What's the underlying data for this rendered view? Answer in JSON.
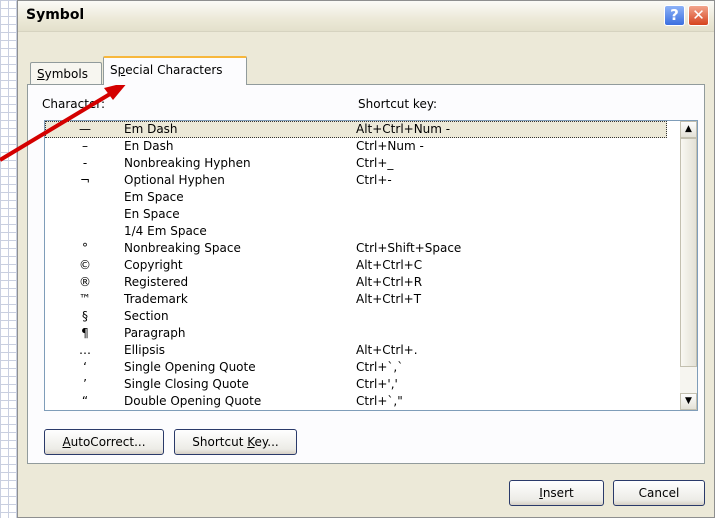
{
  "window": {
    "title": "Symbol"
  },
  "titlebar": {
    "help_glyph": "?",
    "close_glyph": "✕"
  },
  "tabs": [
    {
      "label_pre": "",
      "label_key": "S",
      "label_post": "ymbols"
    },
    {
      "label_pre": "S",
      "label_key": "p",
      "label_post": "ecial Characters"
    }
  ],
  "list": {
    "header_character": "Character:",
    "header_shortcut": "Shortcut key:",
    "rows": [
      {
        "symbol": "—",
        "name": "Em Dash",
        "shortcut": "Alt+Ctrl+Num -"
      },
      {
        "symbol": "–",
        "name": "En Dash",
        "shortcut": "Ctrl+Num -"
      },
      {
        "symbol": "-",
        "name": "Nonbreaking Hyphen",
        "shortcut": "Ctrl+_"
      },
      {
        "symbol": "¬",
        "name": "Optional Hyphen",
        "shortcut": "Ctrl+-"
      },
      {
        "symbol": "",
        "name": "Em Space",
        "shortcut": ""
      },
      {
        "symbol": "",
        "name": "En Space",
        "shortcut": ""
      },
      {
        "symbol": "",
        "name": "1/4 Em Space",
        "shortcut": ""
      },
      {
        "symbol": "°",
        "name": "Nonbreaking Space",
        "shortcut": "Ctrl+Shift+Space"
      },
      {
        "symbol": "©",
        "name": "Copyright",
        "shortcut": "Alt+Ctrl+C"
      },
      {
        "symbol": "®",
        "name": "Registered",
        "shortcut": "Alt+Ctrl+R"
      },
      {
        "symbol": "™",
        "name": "Trademark",
        "shortcut": "Alt+Ctrl+T"
      },
      {
        "symbol": "§",
        "name": "Section",
        "shortcut": ""
      },
      {
        "symbol": "¶",
        "name": "Paragraph",
        "shortcut": ""
      },
      {
        "symbol": "…",
        "name": "Ellipsis",
        "shortcut": "Alt+Ctrl+."
      },
      {
        "symbol": "‘",
        "name": "Single Opening Quote",
        "shortcut": "Ctrl+`,`"
      },
      {
        "symbol": "’",
        "name": "Single Closing Quote",
        "shortcut": "Ctrl+',' "
      },
      {
        "symbol": "“",
        "name": "Double Opening Quote",
        "shortcut": "Ctrl+`,\""
      }
    ],
    "selected_index": 0
  },
  "scrollbar": {
    "up_glyph": "▲",
    "down_glyph": "▼"
  },
  "buttons": {
    "autocorrect_key": "A",
    "autocorrect_post": "utoCorrect...",
    "shortcut_pre": "Shortcut ",
    "shortcut_key": "K",
    "shortcut_post": "ey...",
    "insert_key": "I",
    "insert_post": "nsert",
    "cancel": "Cancel"
  },
  "colors": {
    "annotation_arrow": "#d40000",
    "tab_highlight": "#f7b73c"
  }
}
